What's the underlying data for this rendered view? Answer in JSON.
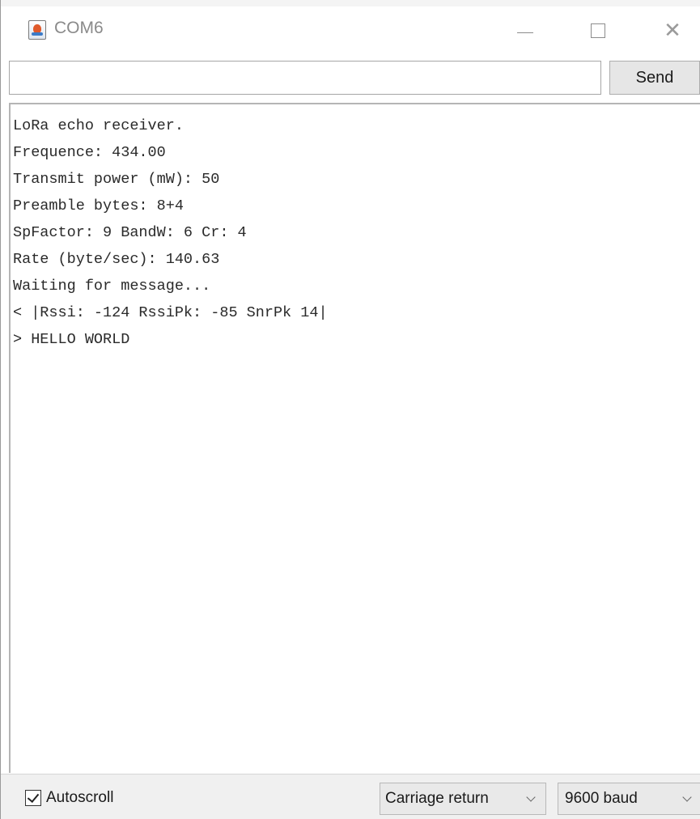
{
  "window": {
    "title": "COM6",
    "icon": "java-app-icon",
    "controls": [
      "minimize-icon",
      "maximize-icon",
      "close-icon"
    ],
    "close_glyph": "✕"
  },
  "send_bar": {
    "input_value": "",
    "input_placeholder": "",
    "send_label": "Send"
  },
  "output": {
    "lines": [
      "LoRa echo receiver.",
      "Frequence: 434.00",
      "Transmit power (mW): 50",
      "Preamble bytes: 8+4",
      "SpFactor: 9 BandW: 6 Cr: 4",
      "Rate (byte/sec): 140.63",
      "Waiting for message...",
      "< |Rssi: -124 RssiPk: -85 SnrPk 14|",
      "> HELLO WORLD"
    ]
  },
  "status_bar": {
    "autoscroll_label": "Autoscroll",
    "autoscroll_checked": true,
    "line_ending_selected": "Carriage return",
    "baud_selected": "9600 baud"
  },
  "colors": {
    "title_text": "#8a8a8a",
    "button_bg": "#e6e6e6",
    "status_bg": "#f0f0f0",
    "output_text": "#2a2a2a"
  }
}
